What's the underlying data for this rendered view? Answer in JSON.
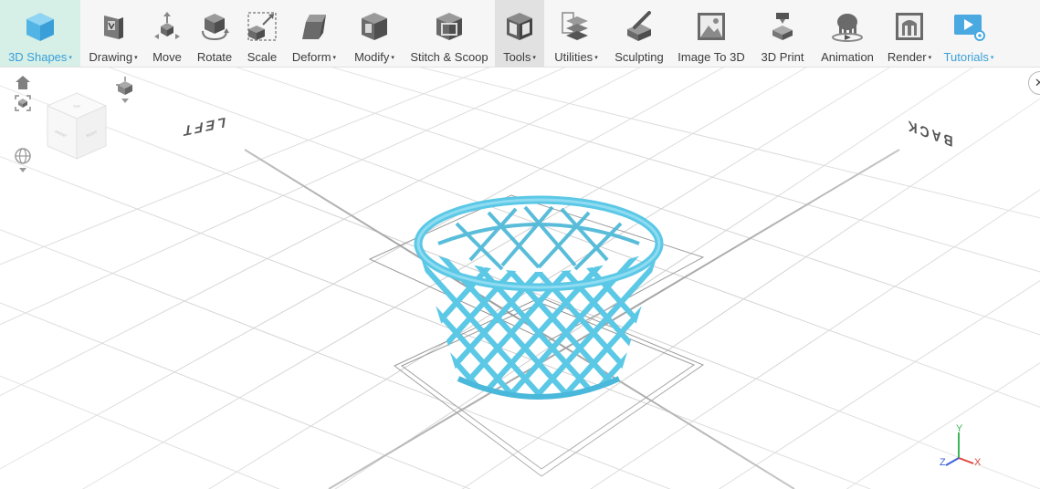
{
  "toolbar": {
    "items": [
      {
        "label": "3D Shapes",
        "dropdown": true,
        "icon": "cube-icon"
      },
      {
        "label": "Drawing",
        "dropdown": true,
        "icon": "drawing-icon"
      },
      {
        "label": "Move",
        "dropdown": false,
        "icon": "move-icon"
      },
      {
        "label": "Rotate",
        "dropdown": false,
        "icon": "rotate-icon"
      },
      {
        "label": "Scale",
        "dropdown": false,
        "icon": "scale-icon"
      },
      {
        "label": "Deform",
        "dropdown": true,
        "icon": "deform-icon"
      },
      {
        "label": "Modify",
        "dropdown": true,
        "icon": "modify-icon"
      },
      {
        "label": "Stitch & Scoop",
        "dropdown": false,
        "icon": "stitch-scoop-icon"
      },
      {
        "label": "Tools",
        "dropdown": true,
        "icon": "tools-icon"
      },
      {
        "label": "Utilities",
        "dropdown": true,
        "icon": "utilities-icon"
      },
      {
        "label": "Sculpting",
        "dropdown": false,
        "icon": "sculpting-icon"
      },
      {
        "label": "Image To 3D",
        "dropdown": false,
        "icon": "image-to-3d-icon"
      },
      {
        "label": "3D Print",
        "dropdown": false,
        "icon": "3d-print-icon"
      },
      {
        "label": "Animation",
        "dropdown": false,
        "icon": "animation-icon"
      },
      {
        "label": "Render",
        "dropdown": true,
        "icon": "render-icon"
      },
      {
        "label": "Tutorials",
        "dropdown": true,
        "icon": "tutorials-icon"
      }
    ],
    "caret": "▾"
  },
  "viewport": {
    "floor_labels": {
      "left": "LEFT",
      "back": "BACK"
    },
    "close_glyph": "✕",
    "viewcube_faces": {
      "front": "FRONT",
      "right": "RIGHT",
      "top": "TOP"
    },
    "axis_labels": {
      "x": "X",
      "y": "Y",
      "z": "Z"
    }
  },
  "colors": {
    "accent": "#3a9fd8",
    "model": "#5bc8e6",
    "active_bg": "#d6efe7",
    "axis_x": "#e0453c",
    "axis_y": "#3cb55a",
    "axis_z": "#3d62d8"
  }
}
